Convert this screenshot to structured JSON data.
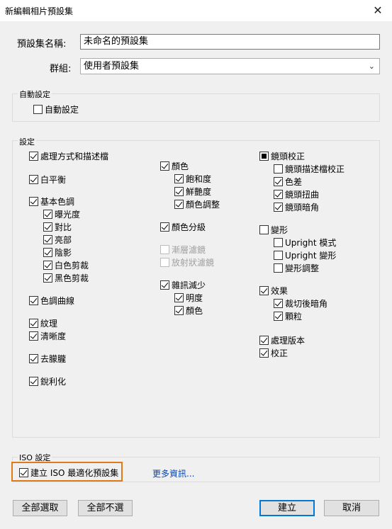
{
  "window": {
    "title": "新編輯相片預設集",
    "close_glyph": "✕"
  },
  "preset_name": {
    "label": "預設集名稱:",
    "value": "未命名的預設集"
  },
  "group": {
    "label": "群組:",
    "value": "使用者預設集"
  },
  "auto_settings": {
    "title": "自動設定",
    "checkbox_label": "自動設定"
  },
  "settings": {
    "title": "設定",
    "col1": {
      "process": "處理方式和描述檔",
      "white_balance": "白平衡",
      "basic_tone": "基本色調",
      "exposure": "曝光度",
      "contrast": "對比",
      "highlights": "亮部",
      "shadows": "陰影",
      "white_clip": "白色剪裁",
      "black_clip": "黑色剪裁",
      "tone_curve": "色調曲線",
      "texture": "紋理",
      "clarity": "清晰度",
      "dehaze": "去朦朧",
      "sharpening": "銳利化"
    },
    "col2": {
      "color": "顏色",
      "saturation": "飽和度",
      "vibrance": "鮮艷度",
      "color_adjust": "顏色調整",
      "color_grading": "顏色分級",
      "graduated_filters": "漸層濾鏡",
      "radial_filters": "放射狀濾鏡",
      "noise_reduction": "雜訊減少",
      "luminance": "明度",
      "nr_color": "顏色"
    },
    "col3": {
      "lens_corrections": "鏡頭校正",
      "lens_profile": "鏡頭描述檔校正",
      "chromatic": "色差",
      "lens_distortion": "鏡頭扭曲",
      "lens_vignetting": "鏡頭暗角",
      "transform": "變形",
      "upright_mode": "Upright 模式",
      "upright_transform": "Upright 變形",
      "transform_adjust": "變形調整",
      "effects": "效果",
      "post_crop_vignetting": "裁切後暗角",
      "grain": "顆粒",
      "process_version": "處理版本",
      "calibration": "校正"
    }
  },
  "iso": {
    "title": "ISO 設定",
    "checkbox_label": "建立 ISO 最適化預設集",
    "more_info": "更多資訊..."
  },
  "buttons": {
    "check_all": "全部選取",
    "check_none": "全部不選",
    "create": "建立",
    "cancel": "取消"
  },
  "colors": {
    "highlight_border": "#e07b1a",
    "link": "#0645ad",
    "primary_border": "#0078d7"
  }
}
